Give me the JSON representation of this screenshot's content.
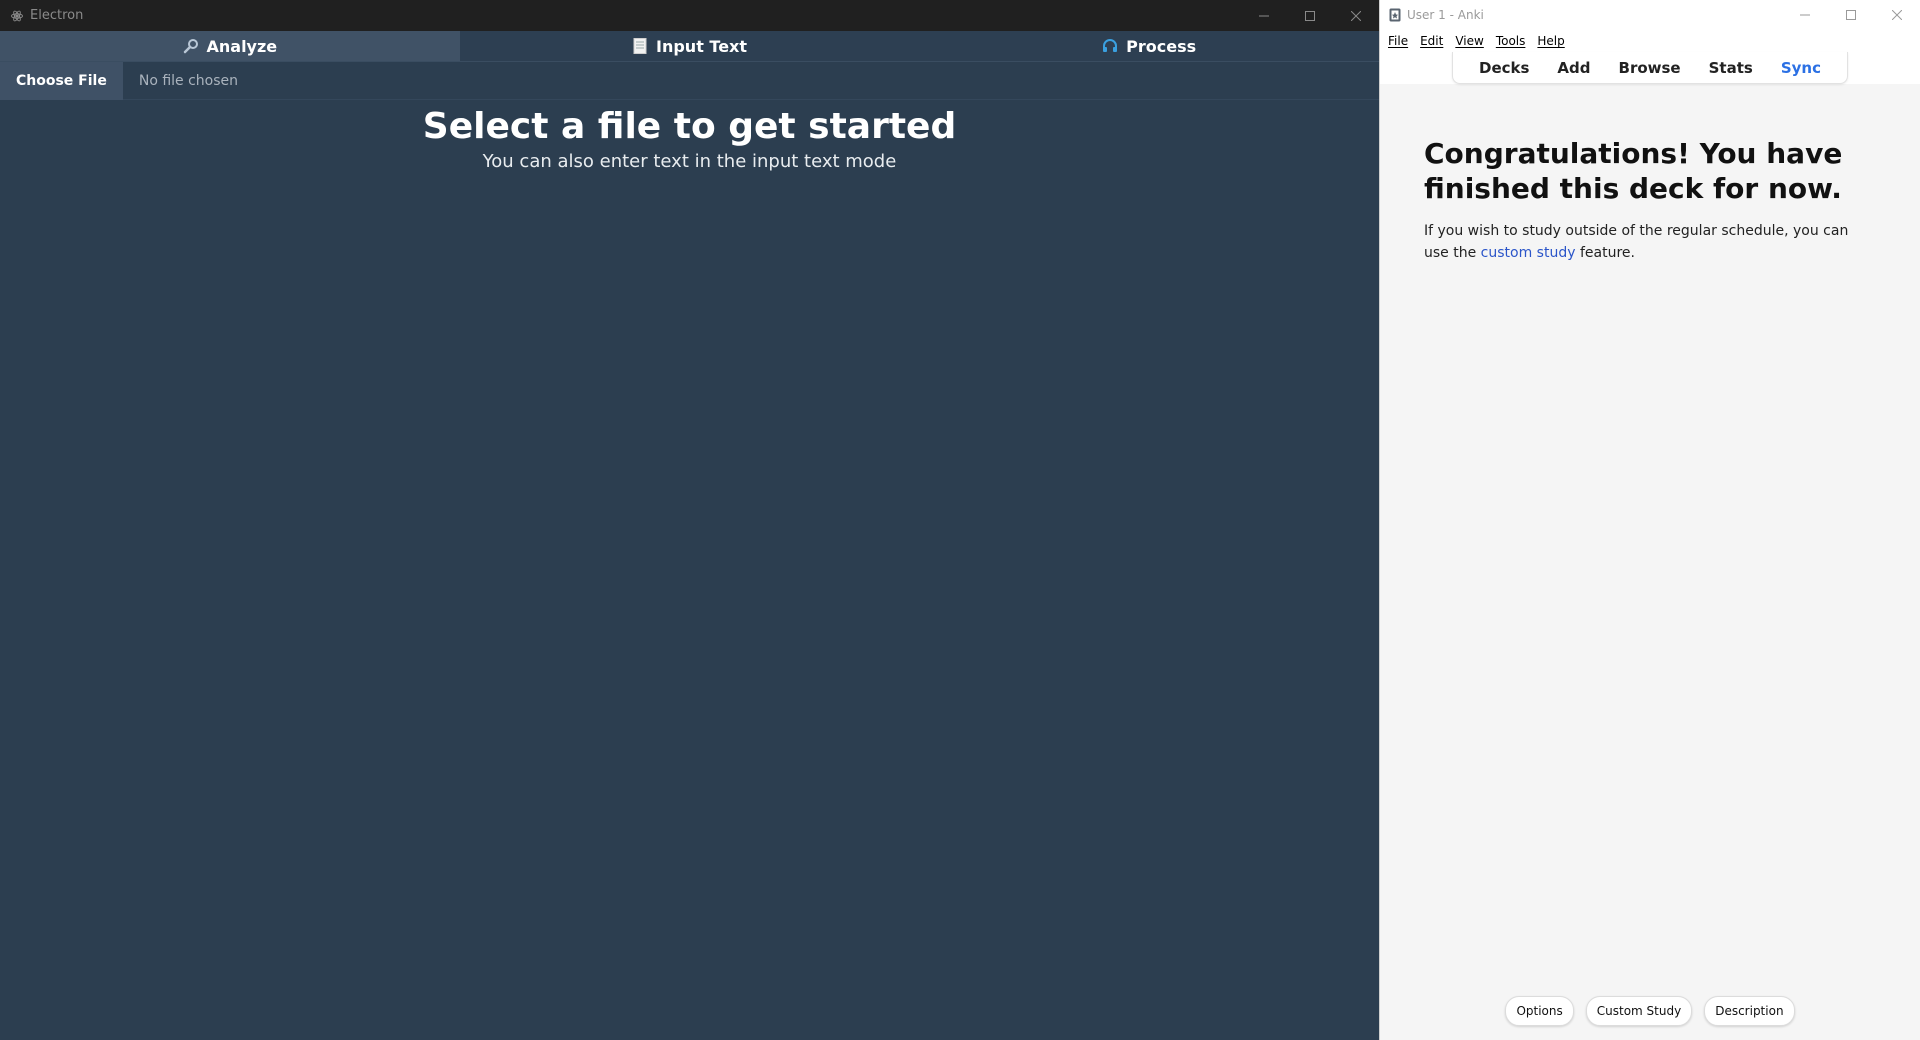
{
  "electron": {
    "title": "Electron",
    "tabs": [
      {
        "label": "Analyze",
        "icon": "magnifier-icon"
      },
      {
        "label": "Input Text",
        "icon": "document-icon"
      },
      {
        "label": "Process",
        "icon": "headset-icon"
      }
    ],
    "choose_file_label": "Choose File",
    "no_file_text": "No file chosen",
    "heading": "Select a file to get started",
    "subheading": "You can also enter text in the input text mode",
    "colors": {
      "background": "#2c3e50",
      "titlebar": "#202020"
    }
  },
  "anki": {
    "title": "User 1 - Anki",
    "menu": [
      "File",
      "Edit",
      "View",
      "Tools",
      "Help"
    ],
    "toolbar": [
      "Decks",
      "Add",
      "Browse",
      "Stats",
      "Sync"
    ],
    "heading": "Congratulations! You have finished this deck for now.",
    "body_prefix": "If you wish to study outside of the regular schedule, you can use the",
    "body_link": "custom study",
    "body_suffix": "feature.",
    "bottom_buttons": [
      "Options",
      "Custom Study",
      "Description"
    ],
    "colors": {
      "sync": "#2b70e4",
      "link": "#2b55c9",
      "background": "#f5f5f5"
    }
  }
}
